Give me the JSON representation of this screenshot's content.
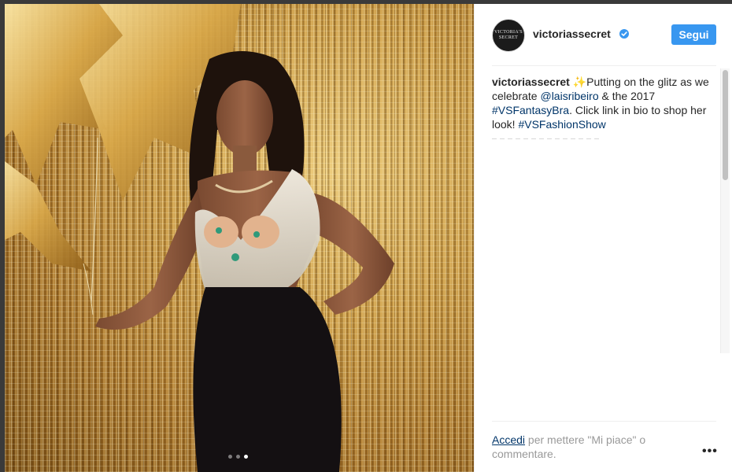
{
  "post": {
    "image_alt": "Model in gold lingerie with gold balloons",
    "carousel": {
      "count": 3,
      "active_index": 2
    }
  },
  "header": {
    "avatar_text": "VICTORIA'S SECRET",
    "username": "victoriassecret",
    "verified": true,
    "follow_label": "Segui"
  },
  "caption": {
    "username": "victoriassecret",
    "emoji": "✨",
    "text_1": "Putting on the glitz as we celebrate ",
    "mention": "@laisribeiro",
    "text_2": " & the 2017 ",
    "hashtag_1": "#VSFantasyBra",
    "text_3": ". Click link in bio to shop her look! ",
    "hashtag_2": "#VSFashionShow"
  },
  "footer": {
    "login_link": "Accedi",
    "login_text": " per mettere \"Mi piace\" o commentare.",
    "more_label": "•••"
  },
  "colors": {
    "accent": "#3897f0",
    "link": "#003569",
    "text": "#262626",
    "muted": "#999999"
  }
}
